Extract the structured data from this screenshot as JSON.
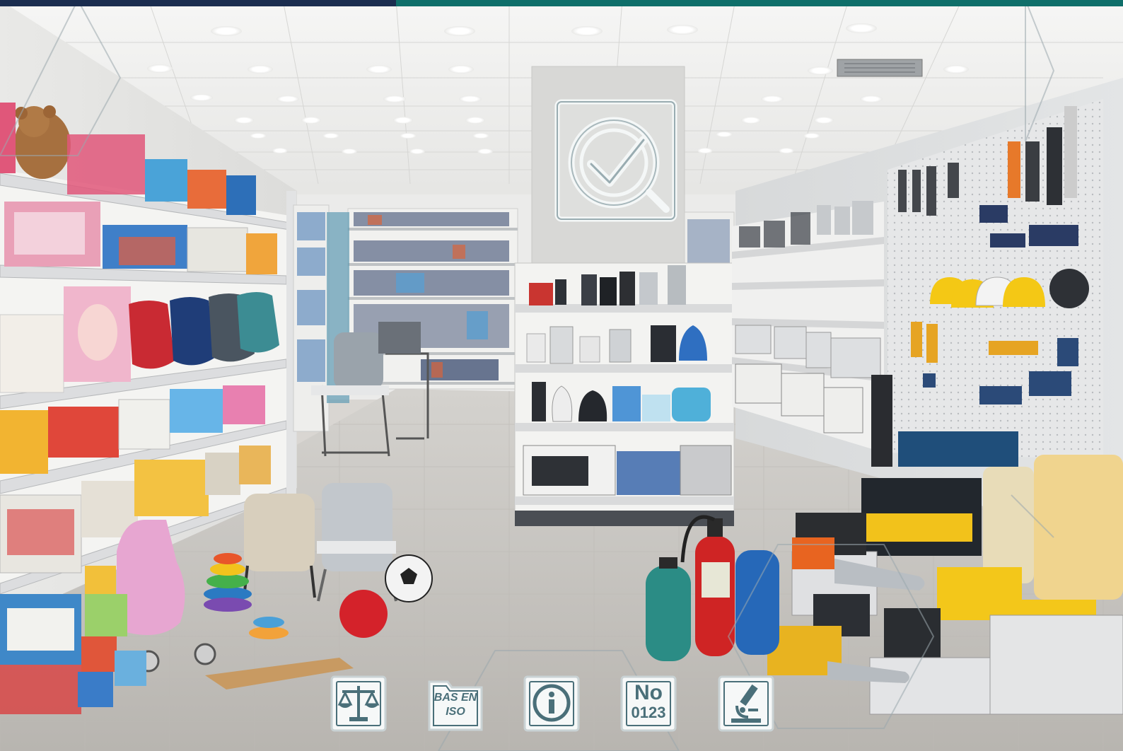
{
  "scene": {
    "description_colors": {
      "ceiling": "#eeeeec",
      "floor": "#c9c6c1",
      "shelf": "#f2f2f0",
      "accent_navy": "#1b2d4f",
      "accent_teal": "#0f6f6a",
      "icon_teal": "#4a6f79"
    }
  },
  "center_logo": {
    "icon": "check-badge-icon"
  },
  "badges": [
    {
      "icon": "scales-icon"
    },
    {
      "icon": "folder-icon",
      "line1": "BAS EN",
      "line2": "ISO"
    },
    {
      "icon": "info-icon"
    },
    {
      "icon": "number-icon",
      "label_top": "No",
      "label_bottom": "0123"
    },
    {
      "icon": "microscope-icon"
    }
  ]
}
